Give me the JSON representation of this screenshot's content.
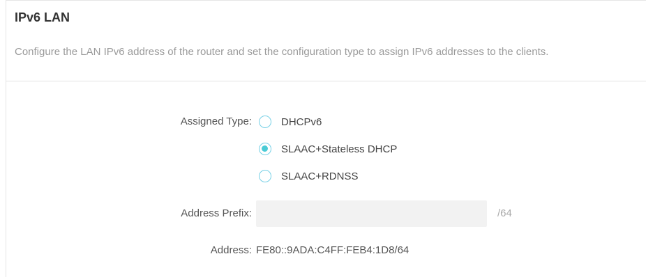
{
  "section": {
    "title": "IPv6 LAN",
    "description": "Configure the LAN IPv6 address of the router and set the configuration type to assign IPv6 addresses to the clients."
  },
  "assigned_type": {
    "label": "Assigned Type:",
    "options": [
      {
        "label": "DHCPv6",
        "checked": false
      },
      {
        "label": "SLAAC+Stateless DHCP",
        "checked": true
      },
      {
        "label": "SLAAC+RDNSS",
        "checked": false
      }
    ]
  },
  "address_prefix": {
    "label": "Address Prefix:",
    "value": "",
    "suffix": "/64"
  },
  "address": {
    "label": "Address:",
    "value": "FE80::9ADA:C4FF:FEB4:1D8/64"
  },
  "colors": {
    "accent": "#4acbd6",
    "radio_border": "#76d0e6",
    "input_bg": "#f2f2f2"
  }
}
